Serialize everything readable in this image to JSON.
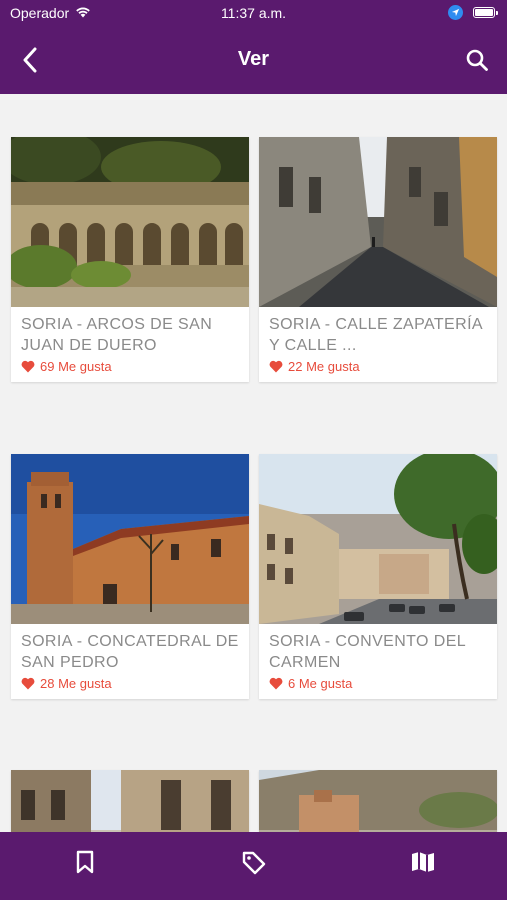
{
  "status": {
    "carrier": "Operador",
    "time": "11:37 a.m."
  },
  "header": {
    "title": "Ver"
  },
  "cards": [
    {
      "title": "SORIA - ARCOS DE SAN JUAN DE DUERO",
      "likes": "69 Me gusta"
    },
    {
      "title": "SORIA - CALLE ZAPATERÍA Y CALLE ...",
      "likes": "22 Me gusta"
    },
    {
      "title": "SORIA - CONCATEDRAL DE SAN PEDRO",
      "likes": "28 Me gusta"
    },
    {
      "title": "SORIA - CONVENTO DEL CARMEN",
      "likes": "6 Me gusta"
    }
  ],
  "tabs": [
    "bookmark-icon",
    "tag-icon",
    "map-icon"
  ],
  "colors": {
    "brand": "#5a1a6e",
    "like": "#e74c3c"
  }
}
